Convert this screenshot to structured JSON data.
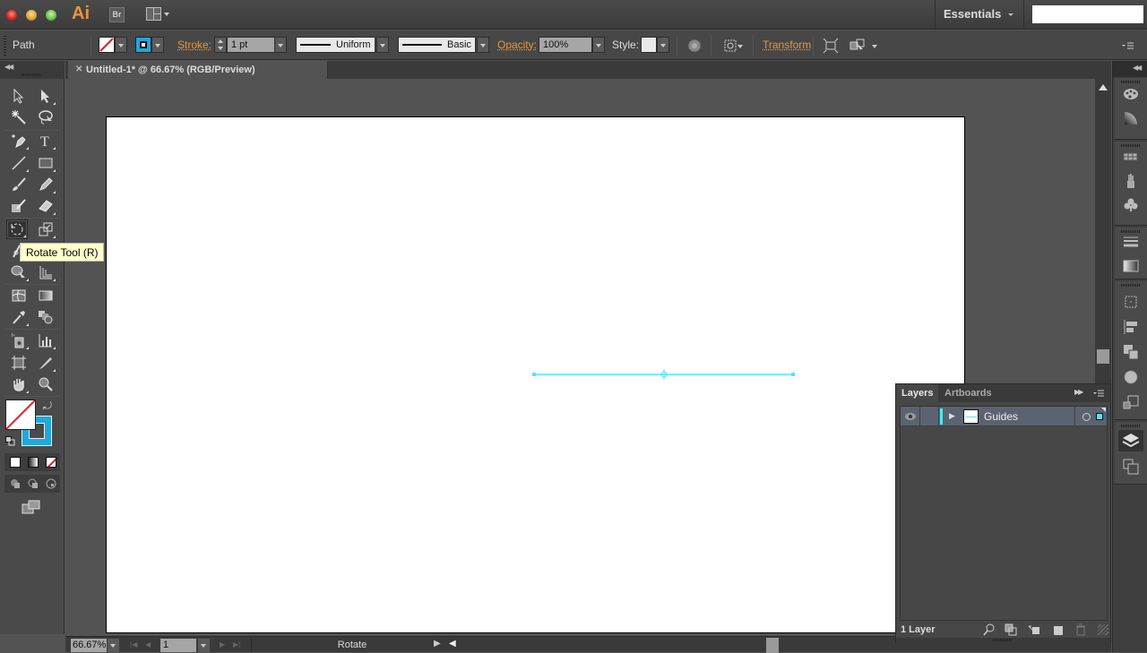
{
  "app": {
    "logo": "Ai",
    "bridge_label": "Br",
    "workspace": "Essentials",
    "search_placeholder": ""
  },
  "control_bar": {
    "selection_type": "Path",
    "fill_icon": "none-swatch-icon",
    "stroke_icon": "stroke-swatch-icon",
    "stroke_label": "Stroke:",
    "stroke_weight": "1 pt",
    "variable_width_profile": "Uniform",
    "brush_definition": "Basic",
    "opacity_label": "Opacity:",
    "opacity_value": "100%",
    "style_label": "Style:",
    "transform_label": "Transform",
    "colors": {
      "accent_link": "#e8963c",
      "stroke_blue": "#1fa8dc",
      "none_red": "#e0202a"
    }
  },
  "document": {
    "tab_title": "Untitled-1* @ 66.67% (RGB/Preview)",
    "guide_color": "#4ee8f0"
  },
  "tools": {
    "tooltip": "Rotate Tool (R)",
    "items": [
      {
        "name": "selection-tool"
      },
      {
        "name": "direct-selection-tool"
      },
      {
        "name": "magic-wand-tool"
      },
      {
        "name": "lasso-tool"
      },
      {
        "name": "pen-tool"
      },
      {
        "name": "type-tool"
      },
      {
        "name": "line-segment-tool"
      },
      {
        "name": "rectangle-tool"
      },
      {
        "name": "paintbrush-tool"
      },
      {
        "name": "pencil-tool"
      },
      {
        "name": "blob-brush-tool"
      },
      {
        "name": "eraser-tool"
      },
      {
        "name": "rotate-tool",
        "active": true
      },
      {
        "name": "scale-tool"
      },
      {
        "name": "width-tool"
      },
      {
        "name": "free-transform-tool"
      },
      {
        "name": "shape-builder-tool"
      },
      {
        "name": "perspective-grid-tool"
      },
      {
        "name": "mesh-tool"
      },
      {
        "name": "gradient-tool"
      },
      {
        "name": "eyedropper-tool"
      },
      {
        "name": "blend-tool"
      },
      {
        "name": "symbol-sprayer-tool"
      },
      {
        "name": "column-graph-tool"
      },
      {
        "name": "artboard-tool"
      },
      {
        "name": "slice-tool"
      },
      {
        "name": "hand-tool"
      },
      {
        "name": "zoom-tool"
      }
    ]
  },
  "status_bar": {
    "zoom": "66.67%",
    "artboard_number": "1",
    "current_tool": "Rotate"
  },
  "layers_panel": {
    "tabs": [
      {
        "label": "Layers",
        "active": true
      },
      {
        "label": "Artboards",
        "active": false
      }
    ],
    "layers": [
      {
        "name": "Guides",
        "visible": true,
        "color": "#4ee8f0"
      }
    ],
    "count_label": "1 Layer"
  },
  "dock": {
    "icons": [
      "color-icon",
      "color-guide-icon",
      "swatches-icon",
      "brushes-icon",
      "symbols-icon",
      "stroke-icon",
      "gradient-icon",
      "transform-icon",
      "align-icon",
      "pathfinder-icon",
      "appearance-icon",
      "graphic-styles-icon",
      "layers-icon",
      "artboards-icon"
    ]
  }
}
